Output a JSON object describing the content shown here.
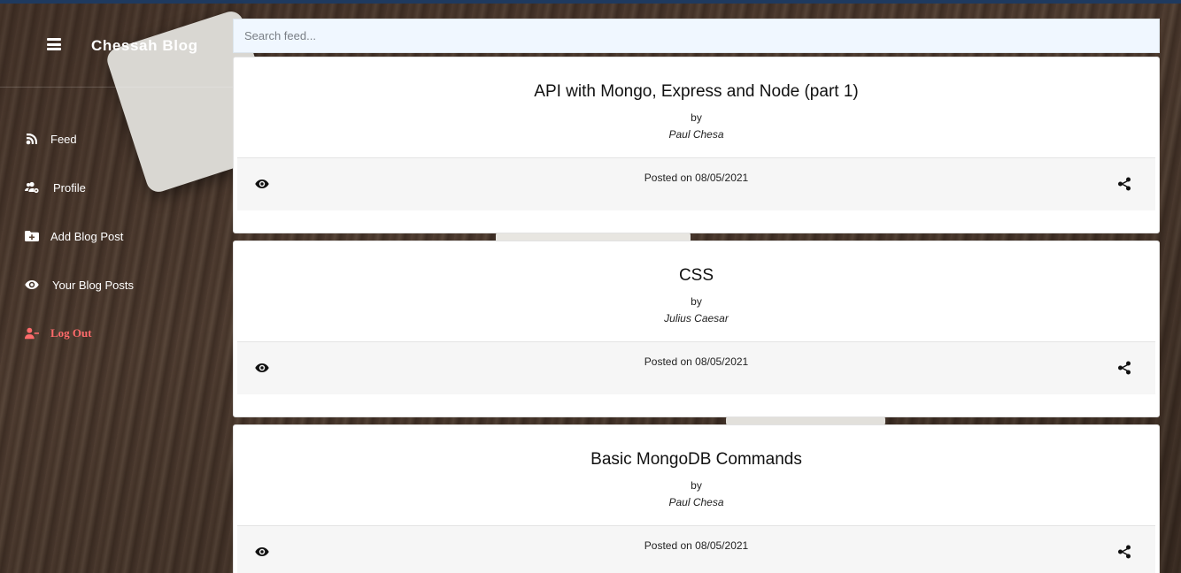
{
  "app": {
    "brand": "Chessah Blog"
  },
  "sidebar": {
    "items": [
      {
        "label": "Feed",
        "icon": "blog-icon"
      },
      {
        "label": "Profile",
        "icon": "users-cog-icon"
      },
      {
        "label": "Add Blog Post",
        "icon": "folder-plus-icon"
      },
      {
        "label": "Your Blog Posts",
        "icon": "eye-icon"
      },
      {
        "label": "Log Out",
        "icon": "user-minus-icon",
        "color": "#ff6b6b"
      }
    ]
  },
  "search": {
    "placeholder": "Search feed..."
  },
  "posts": [
    {
      "title": "API with Mongo, Express and Node (part 1)",
      "by": "by",
      "author": "Paul Chesa",
      "date": "Posted on 08/05/2021"
    },
    {
      "title": "CSS",
      "by": "by",
      "author": "Julius Caesar",
      "date": "Posted on 08/05/2021"
    },
    {
      "title": "Basic MongoDB Commands",
      "by": "by",
      "author": "Paul Chesa",
      "date": "Posted on 08/05/2021"
    }
  ],
  "colors": {
    "accent_bar": "#1f3a5f",
    "logout": "#ff6b6b",
    "search_bg": "#f0f7ff"
  }
}
